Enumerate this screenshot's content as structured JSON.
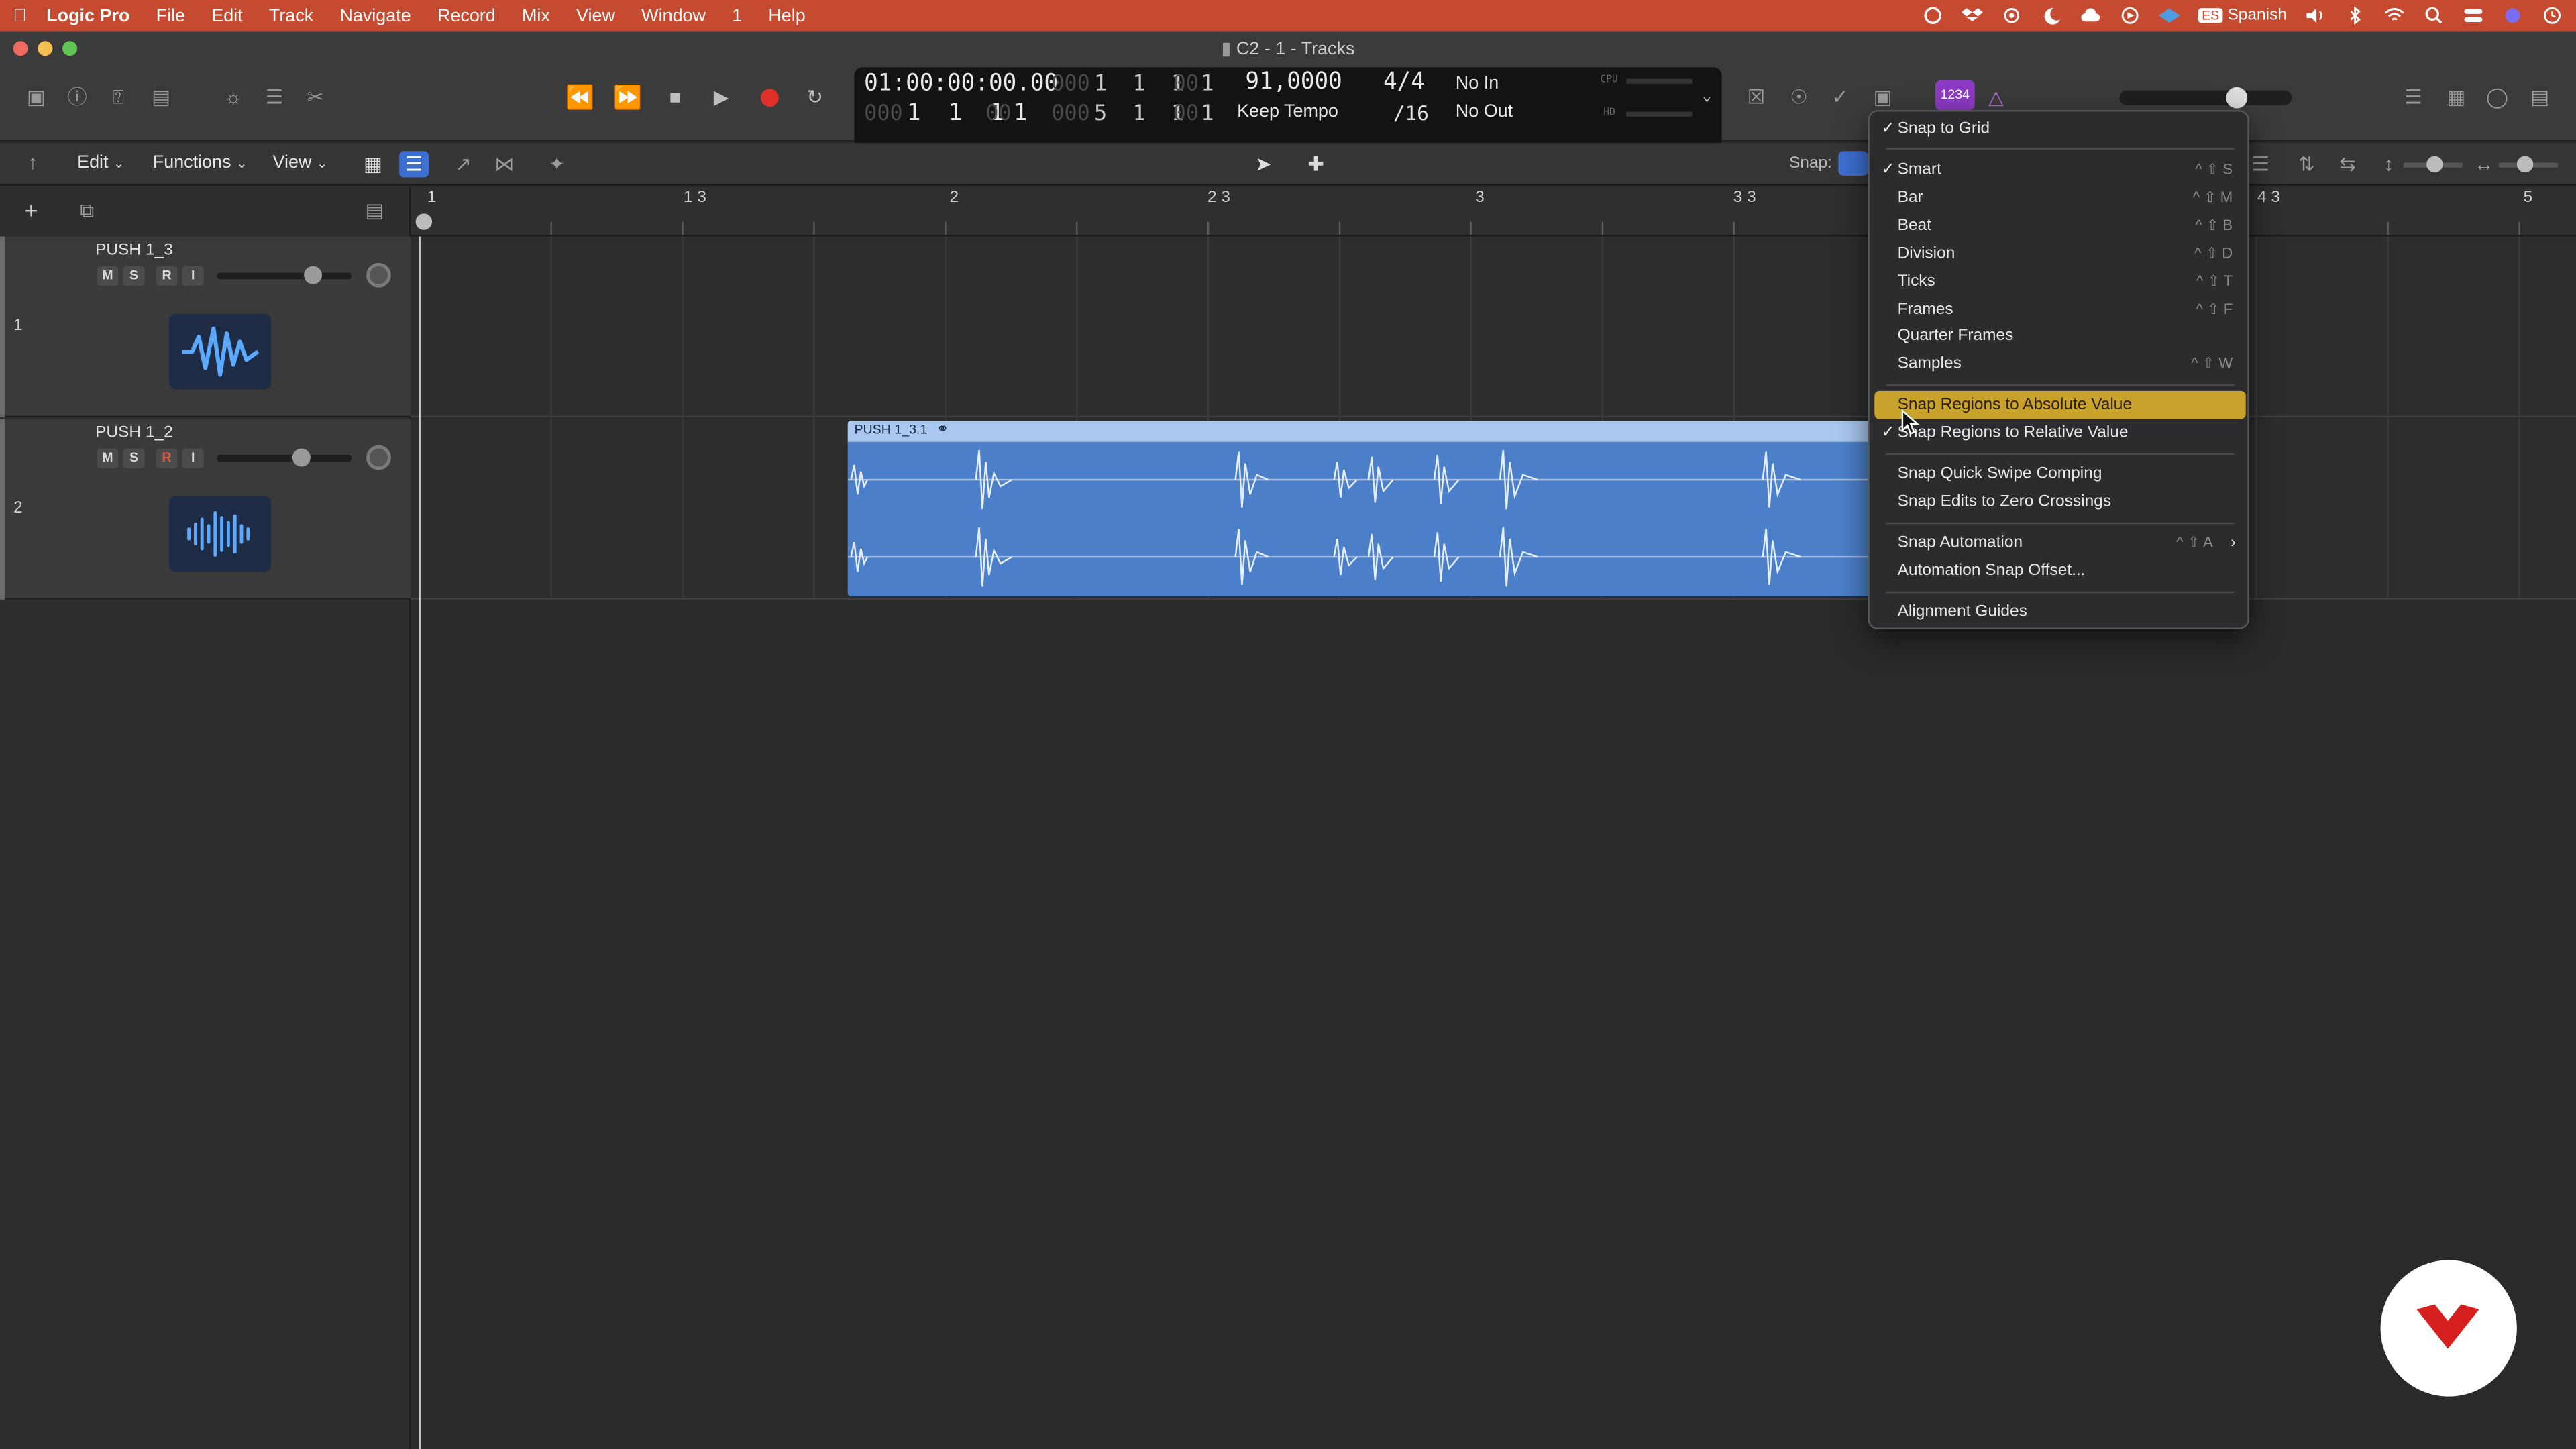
{
  "menubar": {
    "app": "Logic Pro",
    "items": [
      "File",
      "Edit",
      "Track",
      "Navigate",
      "Record",
      "Mix",
      "View",
      "Window",
      "1",
      "Help"
    ],
    "input_source": "Spanish"
  },
  "window": {
    "title": "C2 - 1 - Tracks"
  },
  "lcd": {
    "time": "01:00:00:00.00",
    "bars_top_dim": "000",
    "bars_top": "1  1  1",
    "ticks_top_dim": "00",
    "ticks_top": "1",
    "bars_bottom_dim": "000",
    "bars_bottom": "1  1  1",
    "ticks_bottom_dim": "00",
    "ticks_bottom": "1",
    "bars_end_dim": "000",
    "bars_end": "5  1  1",
    "ticks_end_dim": "00",
    "ticks_end": "1",
    "tempo": "91,0000",
    "tempo_mode": "Keep Tempo",
    "signature": "4/4",
    "division": "/16",
    "in": "No In",
    "out": "No Out",
    "cpu_label": "CPU",
    "hd_label": "HD"
  },
  "control_bar": {
    "count_in": "1234"
  },
  "trackbar": {
    "edit": "Edit",
    "functions": "Functions",
    "view": "View",
    "snap_label": "Snap:"
  },
  "ruler": {
    "labels": [
      "1",
      "1 3",
      "2",
      "2 3",
      "3",
      "3 3",
      "4 3",
      "5"
    ]
  },
  "tracks": [
    {
      "number": "1",
      "name": "PUSH 1_3",
      "m": "M",
      "s": "S",
      "r": "R",
      "i": "I",
      "volume": 0.85
    },
    {
      "number": "2",
      "name": "PUSH 1_2",
      "m": "M",
      "s": "S",
      "r": "R",
      "i": "I",
      "volume": 0.75
    }
  ],
  "region": {
    "name": "PUSH 1_3.1"
  },
  "snap_menu": {
    "snap_to_grid": "Snap to Grid",
    "modes": [
      {
        "label": "Smart",
        "shortcut": "^ ⇧ S",
        "checked": true
      },
      {
        "label": "Bar",
        "shortcut": "^ ⇧ M",
        "checked": false
      },
      {
        "label": "Beat",
        "shortcut": "^ ⇧ B",
        "checked": false
      },
      {
        "label": "Division",
        "shortcut": "^ ⇧ D",
        "checked": false
      },
      {
        "label": "Ticks",
        "shortcut": "^ ⇧ T",
        "checked": false
      },
      {
        "label": "Frames",
        "shortcut": "^ ⇧ F",
        "checked": false
      },
      {
        "label": "Quarter Frames",
        "shortcut": "",
        "checked": false
      },
      {
        "label": "Samples",
        "shortcut": "^ ⇧ W",
        "checked": false
      }
    ],
    "absolute": "Snap Regions to Absolute Value",
    "relative": "Snap Regions to Relative Value",
    "quick_swipe": "Snap Quick Swipe Comping",
    "zero_crossings": "Snap Edits to Zero Crossings",
    "automation": "Snap Automation",
    "automation_shortcut": "^ ⇧ A",
    "automation_offset": "Automation Snap Offset...",
    "alignment": "Alignment Guides"
  },
  "colors": {
    "menubar": "#c64a2f",
    "region": "#4b7fc9",
    "menu_highlight": "#c8a22a",
    "record": "#e0302a",
    "count_in": "#8d3bc4"
  }
}
